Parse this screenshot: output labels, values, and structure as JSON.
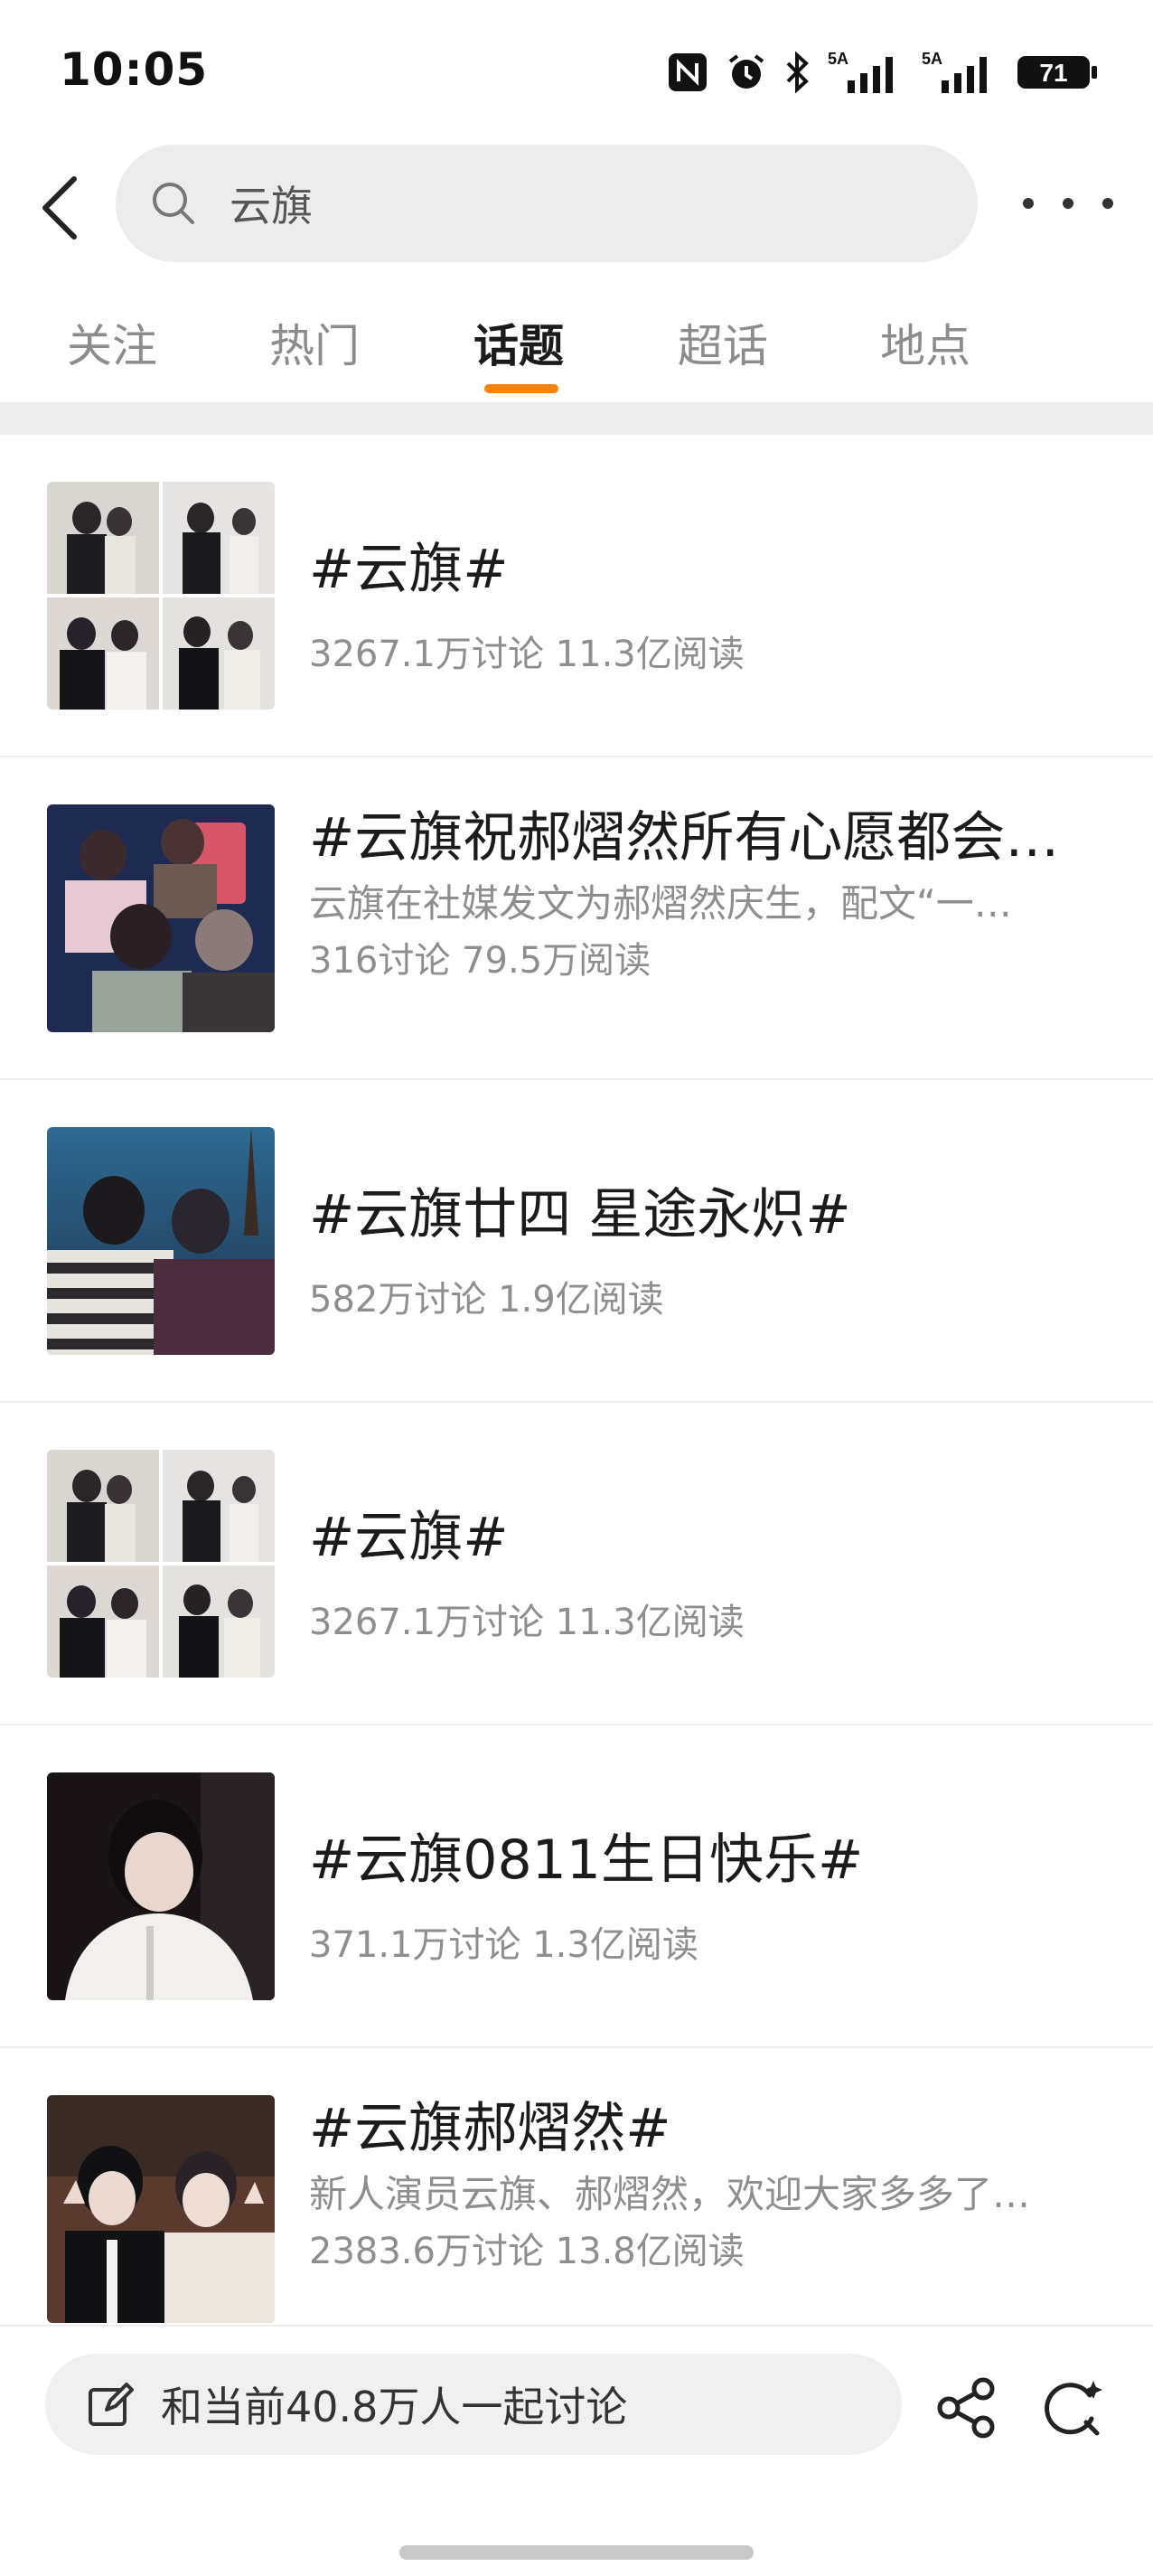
{
  "status_bar": {
    "time": "10:05",
    "battery": "71",
    "signal_label_1": "5A",
    "signal_label_2": "5A"
  },
  "header": {
    "search_value": "云旗",
    "icons": [
      "back-arrow-icon",
      "search-icon",
      "more-dots-icon"
    ]
  },
  "tabs": [
    {
      "label": "关注",
      "active": false
    },
    {
      "label": "热门",
      "active": false
    },
    {
      "label": "话题",
      "active": true
    },
    {
      "label": "超话",
      "active": false
    },
    {
      "label": "地点",
      "active": false
    }
  ],
  "accent_color": "#ff8200",
  "topics": [
    {
      "title": "#云旗#",
      "desc": "",
      "stats": "3267.1万讨论 11.3亿阅读"
    },
    {
      "title": "#云旗祝郝熠然所有心愿都会实…",
      "desc": "云旗在社媒发文为郝熠然庆生，配文“一…",
      "stats": "316讨论 79.5万阅读"
    },
    {
      "title": "#云旗廿四 星途永炽#",
      "desc": "",
      "stats": "582万讨论 1.9亿阅读"
    },
    {
      "title": "#云旗#",
      "desc": "",
      "stats": "3267.1万讨论 11.3亿阅读"
    },
    {
      "title": "#云旗0811生日快乐#",
      "desc": "",
      "stats": "371.1万讨论 1.3亿阅读"
    },
    {
      "title": "#云旗郝熠然#",
      "desc": "新人演员云旗、郝熠然，欢迎大家多多了…",
      "stats": "2383.6万讨论 13.8亿阅读"
    }
  ],
  "bottom_bar": {
    "compose_placeholder": "和当前40.8万人一起讨论",
    "icons": [
      "edit-icon",
      "share-icon",
      "refresh-icon"
    ]
  }
}
